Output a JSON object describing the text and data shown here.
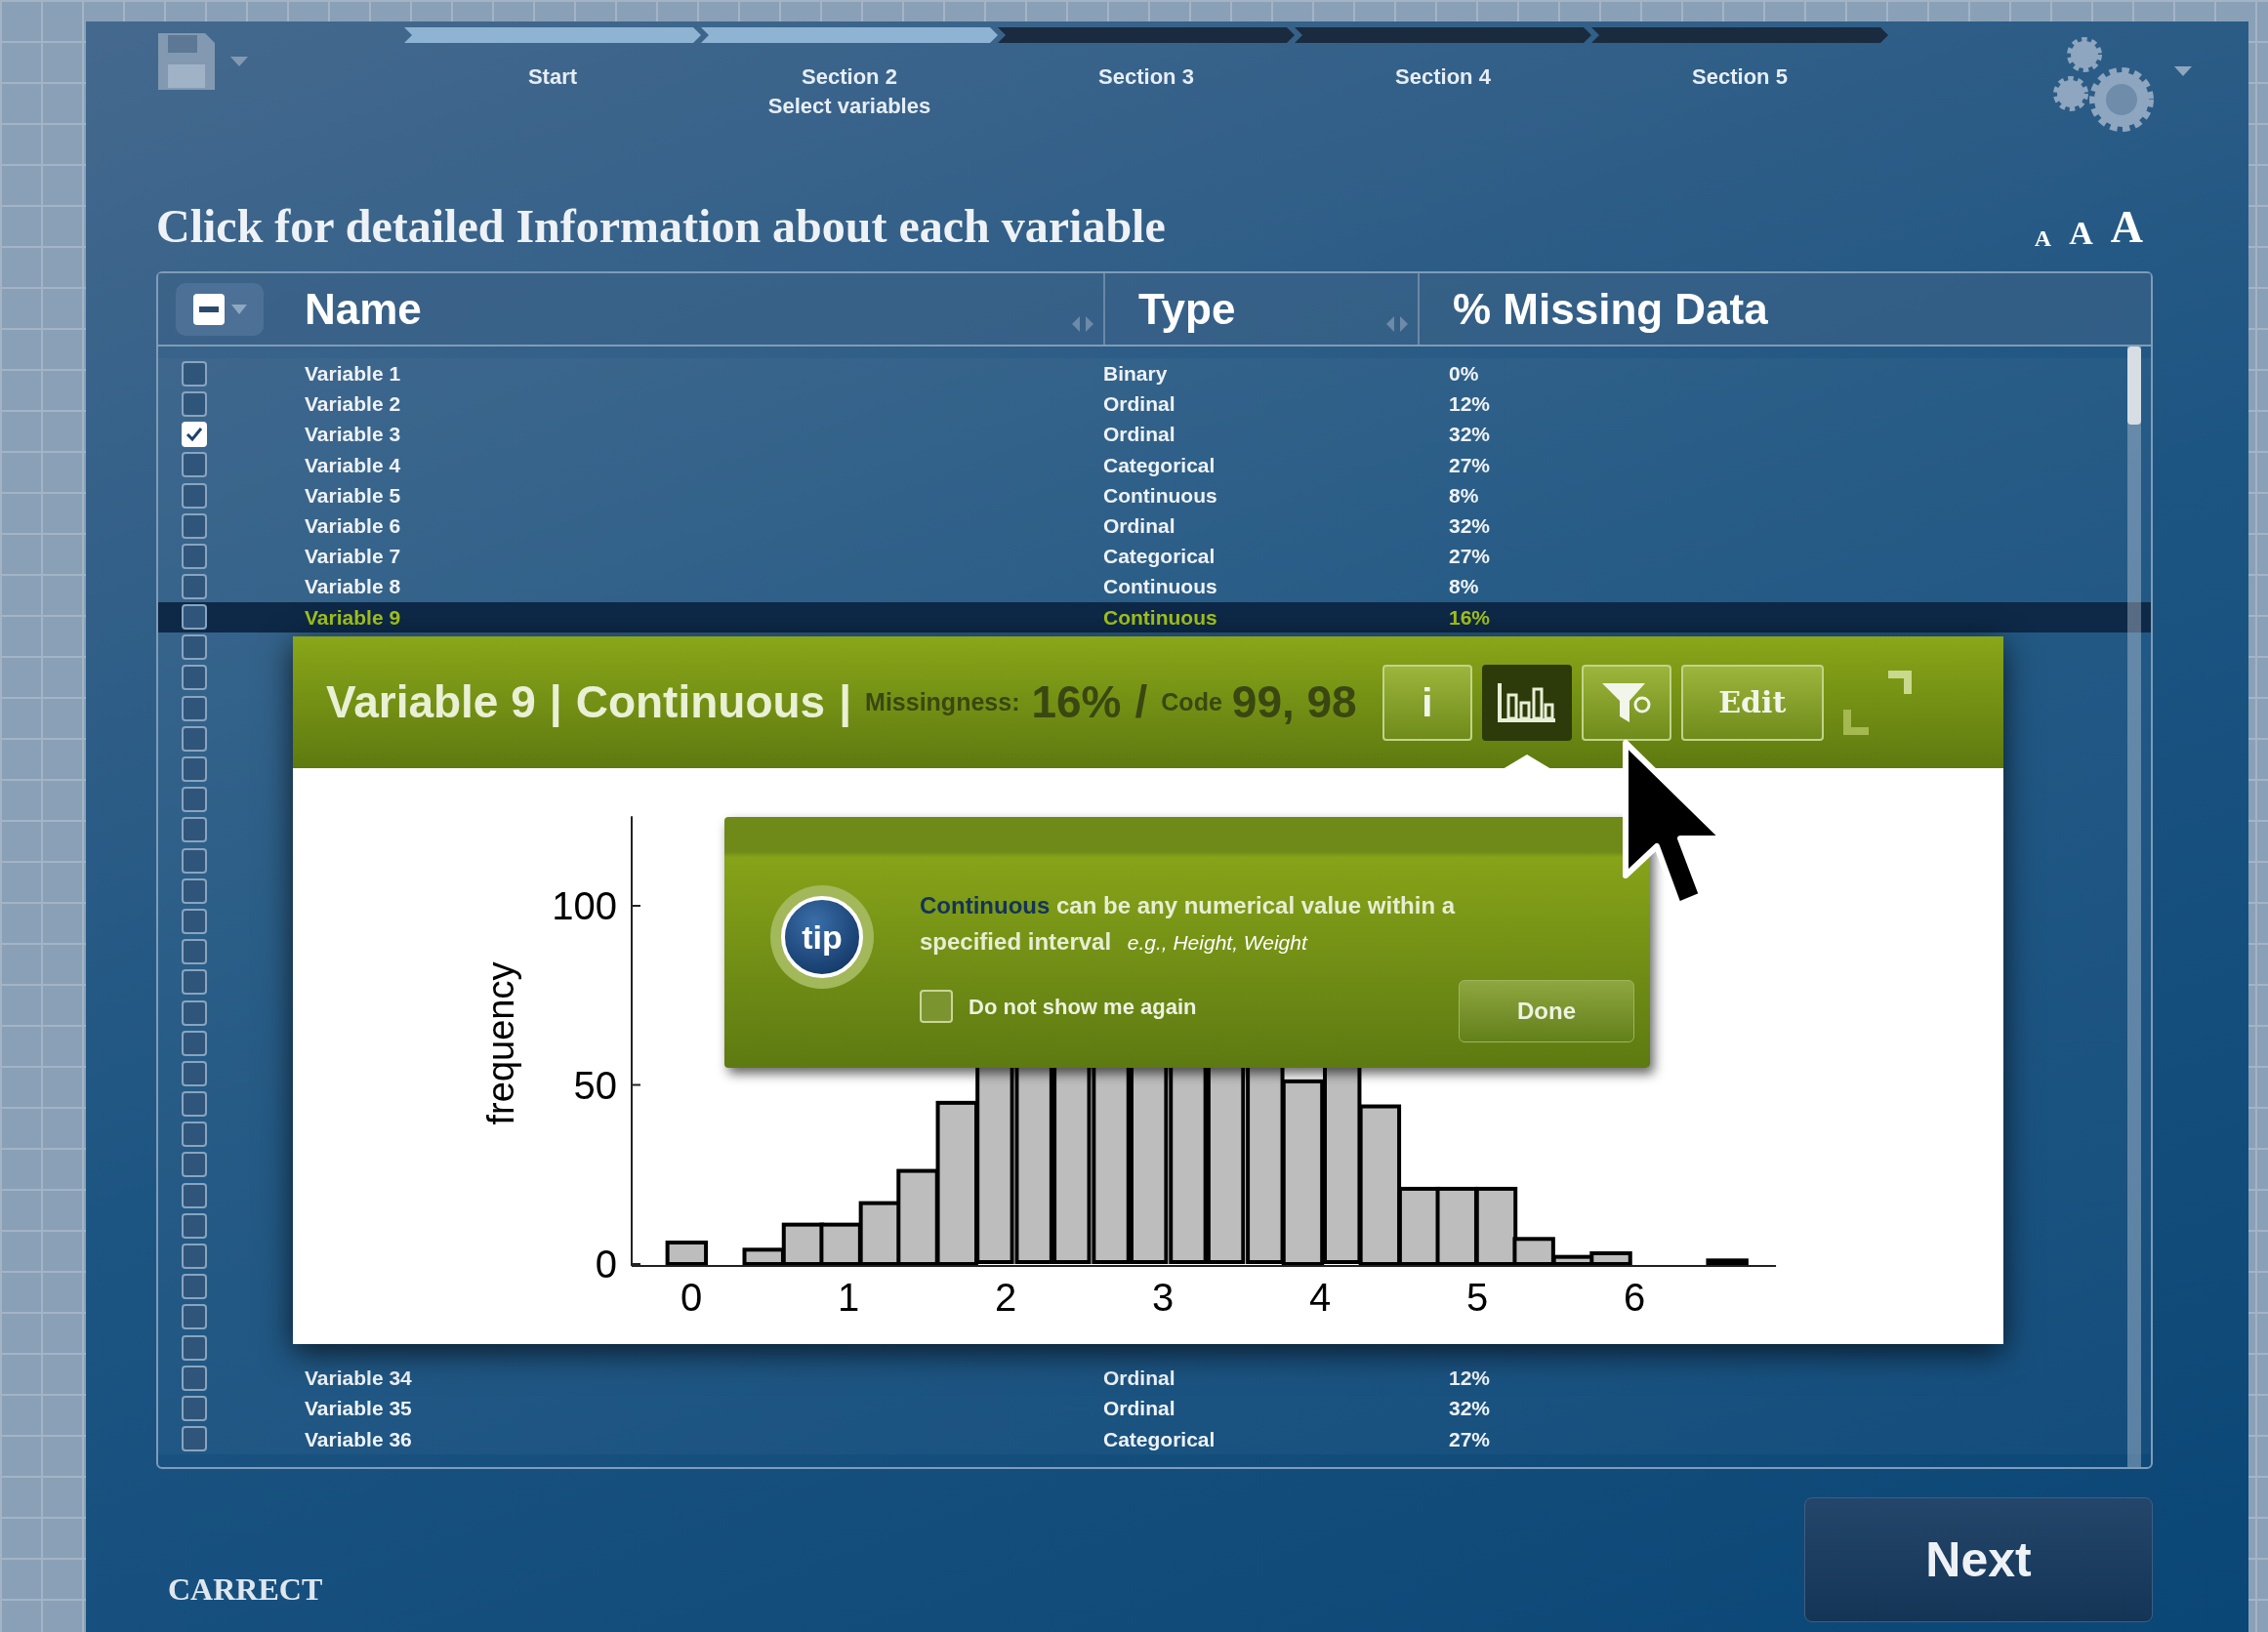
{
  "toolbar": {
    "steps": [
      {
        "label": "Start",
        "completed": true
      },
      {
        "label": "Section 2",
        "caption": "Select variables",
        "completed": true
      },
      {
        "label": "Section 3",
        "completed": false
      },
      {
        "label": "Section 4",
        "completed": false
      },
      {
        "label": "Section 5",
        "completed": false
      }
    ]
  },
  "title": "Click for detailed Information about each variable",
  "text_size_options": [
    "A",
    "A",
    "A"
  ],
  "table": {
    "select_all": {
      "mixed": true
    },
    "columns": [
      "Name",
      "Type",
      "% Missing Data"
    ],
    "rows": [
      {
        "name": "Variable 1",
        "type": "Binary",
        "missing": "0%",
        "checked": false,
        "selected": false
      },
      {
        "name": "Variable 2",
        "type": "Ordinal",
        "missing": "12%",
        "checked": false,
        "selected": false
      },
      {
        "name": "Variable 3",
        "type": "Ordinal",
        "missing": "32%",
        "checked": true,
        "selected": false
      },
      {
        "name": "Variable 4",
        "type": "Categorical",
        "missing": "27%",
        "checked": false,
        "selected": false
      },
      {
        "name": "Variable 5",
        "type": "Continuous",
        "missing": "8%",
        "checked": false,
        "selected": false
      },
      {
        "name": "Variable 6",
        "type": "Ordinal",
        "missing": "32%",
        "checked": false,
        "selected": false
      },
      {
        "name": "Variable 7",
        "type": "Categorical",
        "missing": "27%",
        "checked": false,
        "selected": false
      },
      {
        "name": "Variable 8",
        "type": "Continuous",
        "missing": "8%",
        "checked": false,
        "selected": false
      },
      {
        "name": "Variable 9",
        "type": "Continuous",
        "missing": "16%",
        "checked": false,
        "selected": true
      },
      {
        "checked": false,
        "selected": false
      },
      {
        "checked": false,
        "selected": false
      },
      {
        "checked": false,
        "selected": false
      },
      {
        "checked": false,
        "selected": false
      },
      {
        "checked": false,
        "selected": false
      },
      {
        "checked": false,
        "selected": false
      },
      {
        "checked": false,
        "selected": false
      },
      {
        "checked": false,
        "selected": false
      },
      {
        "checked": false,
        "selected": false
      },
      {
        "checked": false,
        "selected": false
      },
      {
        "checked": false,
        "selected": false
      },
      {
        "checked": false,
        "selected": false
      },
      {
        "checked": false,
        "selected": false
      },
      {
        "checked": false,
        "selected": false
      },
      {
        "checked": false,
        "selected": false
      },
      {
        "checked": false,
        "selected": false
      },
      {
        "checked": false,
        "selected": false
      },
      {
        "checked": false,
        "selected": false
      },
      {
        "checked": false,
        "selected": false
      },
      {
        "checked": false,
        "selected": false
      },
      {
        "checked": false,
        "selected": false
      },
      {
        "checked": false,
        "selected": false
      },
      {
        "checked": false,
        "selected": false
      },
      {
        "checked": false,
        "selected": false
      },
      {
        "name": "Variable 34",
        "type": "Ordinal",
        "missing": "12%",
        "checked": false,
        "selected": false
      },
      {
        "name": "Variable 35",
        "type": "Ordinal",
        "missing": "32%",
        "checked": false,
        "selected": false
      },
      {
        "name": "Variable 36",
        "type": "Categorical",
        "missing": "27%",
        "checked": false,
        "selected": false
      }
    ]
  },
  "detail_panel": {
    "variable": "Variable 9",
    "separator": "|",
    "type": "Continuous",
    "separator_2": "|",
    "missingness_label": "Missingness:",
    "missingness": "16%",
    "slash": "/",
    "code_label": "Code",
    "code": "99, 98",
    "buttons": [
      {
        "kind": "info",
        "label": "i",
        "selected": false
      },
      {
        "kind": "chart",
        "selected": true
      },
      {
        "kind": "filter",
        "selected": false
      },
      {
        "kind": "edit",
        "label": "Edit",
        "selected": false
      }
    ],
    "chart_data": {
      "type": "bar",
      "ylabel": "frequency",
      "x": [
        -0.03,
        0.46,
        0.71,
        0.95,
        1.2,
        1.44,
        1.69,
        1.93,
        2.18,
        2.42,
        2.67,
        2.91,
        3.16,
        3.4,
        3.65,
        3.89,
        4.14,
        4.38,
        4.63,
        4.87,
        5.12,
        5.36,
        5.61,
        5.85,
        6.59
      ],
      "values": [
        6,
        4,
        11,
        11,
        17,
        26,
        45,
        null,
        null,
        null,
        null,
        null,
        null,
        null,
        null,
        51,
        null,
        44,
        21,
        21,
        21,
        7,
        2,
        3,
        1
      ],
      "xlim": [
        -0.38,
        6.9
      ],
      "ylim": [
        0,
        125
      ],
      "xticks": [
        0,
        1,
        2,
        3,
        4,
        5,
        6
      ],
      "yticks": [
        0,
        50,
        100
      ]
    }
  },
  "tip": {
    "badge": "tip",
    "term": "Continuous",
    "text": "can be any numerical value within a specified interval",
    "example": "e.g., Height, Weight",
    "checkbox_label": "Do not show me again",
    "checked": false,
    "button": "Done"
  },
  "next_button": "Next",
  "logo": "CARRECT"
}
